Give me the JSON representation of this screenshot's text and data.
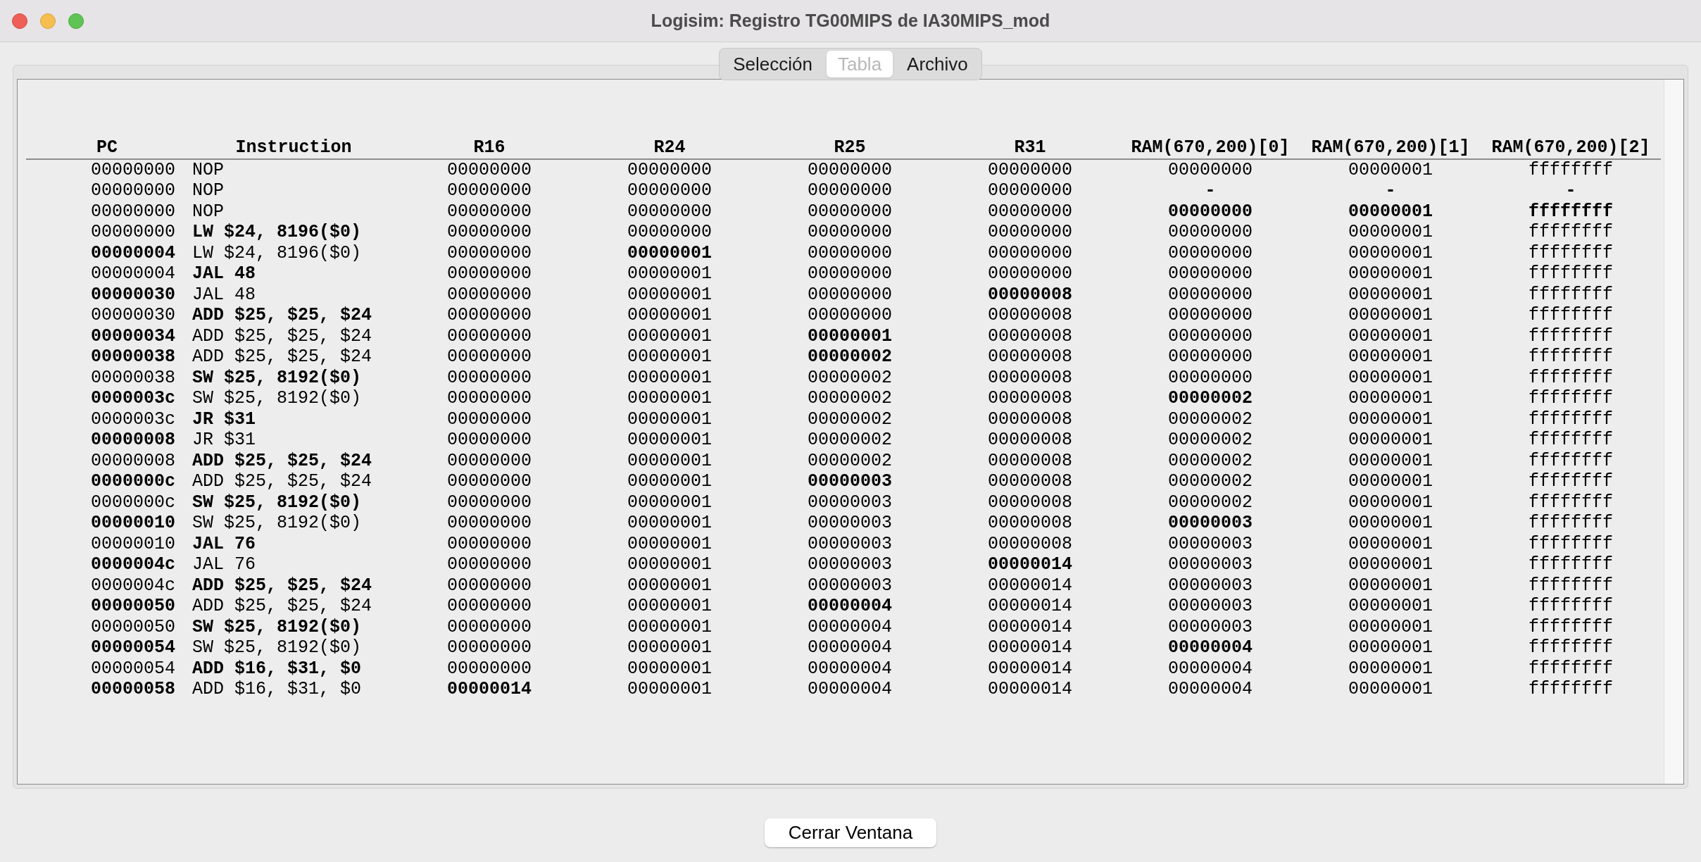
{
  "window": {
    "title": "Logisim: Registro TG00MIPS de IA30MIPS_mod"
  },
  "tabs": [
    {
      "label": "Selección",
      "selected": false
    },
    {
      "label": "Tabla",
      "selected": true
    },
    {
      "label": "Archivo",
      "selected": false
    }
  ],
  "table": {
    "columns": [
      "PC",
      "Instruction",
      "R16",
      "R24",
      "R25",
      "R31",
      "RAM(670,200)[0]",
      "RAM(670,200)[1]",
      "RAM(670,200)[2]"
    ],
    "rows": [
      {
        "cells": [
          {
            "text": "00000000",
            "changed": false
          },
          {
            "text": "NOP",
            "changed": false
          },
          {
            "text": "00000000",
            "changed": false
          },
          {
            "text": "00000000",
            "changed": false
          },
          {
            "text": "00000000",
            "changed": false
          },
          {
            "text": "00000000",
            "changed": false
          },
          {
            "text": "00000000",
            "changed": false
          },
          {
            "text": "00000001",
            "changed": false
          },
          {
            "text": "ffffffff",
            "changed": false
          }
        ]
      },
      {
        "cells": [
          {
            "text": "00000000",
            "changed": false
          },
          {
            "text": "NOP",
            "changed": false
          },
          {
            "text": "00000000",
            "changed": false
          },
          {
            "text": "00000000",
            "changed": false
          },
          {
            "text": "00000000",
            "changed": false
          },
          {
            "text": "00000000",
            "changed": false
          },
          {
            "text": "-",
            "changed": true
          },
          {
            "text": "-",
            "changed": true
          },
          {
            "text": "-",
            "changed": true
          }
        ]
      },
      {
        "cells": [
          {
            "text": "00000000",
            "changed": false
          },
          {
            "text": "NOP",
            "changed": false
          },
          {
            "text": "00000000",
            "changed": false
          },
          {
            "text": "00000000",
            "changed": false
          },
          {
            "text": "00000000",
            "changed": false
          },
          {
            "text": "00000000",
            "changed": false
          },
          {
            "text": "00000000",
            "changed": true
          },
          {
            "text": "00000001",
            "changed": true
          },
          {
            "text": "ffffffff",
            "changed": true
          }
        ]
      },
      {
        "cells": [
          {
            "text": "00000000",
            "changed": false
          },
          {
            "text": "LW $24, 8196($0)",
            "changed": true
          },
          {
            "text": "00000000",
            "changed": false
          },
          {
            "text": "00000000",
            "changed": false
          },
          {
            "text": "00000000",
            "changed": false
          },
          {
            "text": "00000000",
            "changed": false
          },
          {
            "text": "00000000",
            "changed": false
          },
          {
            "text": "00000001",
            "changed": false
          },
          {
            "text": "ffffffff",
            "changed": false
          }
        ]
      },
      {
        "cells": [
          {
            "text": "00000004",
            "changed": true
          },
          {
            "text": "LW $24, 8196($0)",
            "changed": false
          },
          {
            "text": "00000000",
            "changed": false
          },
          {
            "text": "00000001",
            "changed": true
          },
          {
            "text": "00000000",
            "changed": false
          },
          {
            "text": "00000000",
            "changed": false
          },
          {
            "text": "00000000",
            "changed": false
          },
          {
            "text": "00000001",
            "changed": false
          },
          {
            "text": "ffffffff",
            "changed": false
          }
        ]
      },
      {
        "cells": [
          {
            "text": "00000004",
            "changed": false
          },
          {
            "text": "JAL 48",
            "changed": true
          },
          {
            "text": "00000000",
            "changed": false
          },
          {
            "text": "00000001",
            "changed": false
          },
          {
            "text": "00000000",
            "changed": false
          },
          {
            "text": "00000000",
            "changed": false
          },
          {
            "text": "00000000",
            "changed": false
          },
          {
            "text": "00000001",
            "changed": false
          },
          {
            "text": "ffffffff",
            "changed": false
          }
        ]
      },
      {
        "cells": [
          {
            "text": "00000030",
            "changed": true
          },
          {
            "text": "JAL 48",
            "changed": false
          },
          {
            "text": "00000000",
            "changed": false
          },
          {
            "text": "00000001",
            "changed": false
          },
          {
            "text": "00000000",
            "changed": false
          },
          {
            "text": "00000008",
            "changed": true
          },
          {
            "text": "00000000",
            "changed": false
          },
          {
            "text": "00000001",
            "changed": false
          },
          {
            "text": "ffffffff",
            "changed": false
          }
        ]
      },
      {
        "cells": [
          {
            "text": "00000030",
            "changed": false
          },
          {
            "text": "ADD $25, $25, $24",
            "changed": true
          },
          {
            "text": "00000000",
            "changed": false
          },
          {
            "text": "00000001",
            "changed": false
          },
          {
            "text": "00000000",
            "changed": false
          },
          {
            "text": "00000008",
            "changed": false
          },
          {
            "text": "00000000",
            "changed": false
          },
          {
            "text": "00000001",
            "changed": false
          },
          {
            "text": "ffffffff",
            "changed": false
          }
        ]
      },
      {
        "cells": [
          {
            "text": "00000034",
            "changed": true
          },
          {
            "text": "ADD $25, $25, $24",
            "changed": false
          },
          {
            "text": "00000000",
            "changed": false
          },
          {
            "text": "00000001",
            "changed": false
          },
          {
            "text": "00000001",
            "changed": true
          },
          {
            "text": "00000008",
            "changed": false
          },
          {
            "text": "00000000",
            "changed": false
          },
          {
            "text": "00000001",
            "changed": false
          },
          {
            "text": "ffffffff",
            "changed": false
          }
        ]
      },
      {
        "cells": [
          {
            "text": "00000038",
            "changed": true
          },
          {
            "text": "ADD $25, $25, $24",
            "changed": false
          },
          {
            "text": "00000000",
            "changed": false
          },
          {
            "text": "00000001",
            "changed": false
          },
          {
            "text": "00000002",
            "changed": true
          },
          {
            "text": "00000008",
            "changed": false
          },
          {
            "text": "00000000",
            "changed": false
          },
          {
            "text": "00000001",
            "changed": false
          },
          {
            "text": "ffffffff",
            "changed": false
          }
        ]
      },
      {
        "cells": [
          {
            "text": "00000038",
            "changed": false
          },
          {
            "text": "SW $25, 8192($0)",
            "changed": true
          },
          {
            "text": "00000000",
            "changed": false
          },
          {
            "text": "00000001",
            "changed": false
          },
          {
            "text": "00000002",
            "changed": false
          },
          {
            "text": "00000008",
            "changed": false
          },
          {
            "text": "00000000",
            "changed": false
          },
          {
            "text": "00000001",
            "changed": false
          },
          {
            "text": "ffffffff",
            "changed": false
          }
        ]
      },
      {
        "cells": [
          {
            "text": "0000003c",
            "changed": true
          },
          {
            "text": "SW $25, 8192($0)",
            "changed": false
          },
          {
            "text": "00000000",
            "changed": false
          },
          {
            "text": "00000001",
            "changed": false
          },
          {
            "text": "00000002",
            "changed": false
          },
          {
            "text": "00000008",
            "changed": false
          },
          {
            "text": "00000002",
            "changed": true
          },
          {
            "text": "00000001",
            "changed": false
          },
          {
            "text": "ffffffff",
            "changed": false
          }
        ]
      },
      {
        "cells": [
          {
            "text": "0000003c",
            "changed": false
          },
          {
            "text": "JR $31",
            "changed": true
          },
          {
            "text": "00000000",
            "changed": false
          },
          {
            "text": "00000001",
            "changed": false
          },
          {
            "text": "00000002",
            "changed": false
          },
          {
            "text": "00000008",
            "changed": false
          },
          {
            "text": "00000002",
            "changed": false
          },
          {
            "text": "00000001",
            "changed": false
          },
          {
            "text": "ffffffff",
            "changed": false
          }
        ]
      },
      {
        "cells": [
          {
            "text": "00000008",
            "changed": true
          },
          {
            "text": "JR $31",
            "changed": false
          },
          {
            "text": "00000000",
            "changed": false
          },
          {
            "text": "00000001",
            "changed": false
          },
          {
            "text": "00000002",
            "changed": false
          },
          {
            "text": "00000008",
            "changed": false
          },
          {
            "text": "00000002",
            "changed": false
          },
          {
            "text": "00000001",
            "changed": false
          },
          {
            "text": "ffffffff",
            "changed": false
          }
        ]
      },
      {
        "cells": [
          {
            "text": "00000008",
            "changed": false
          },
          {
            "text": "ADD $25, $25, $24",
            "changed": true
          },
          {
            "text": "00000000",
            "changed": false
          },
          {
            "text": "00000001",
            "changed": false
          },
          {
            "text": "00000002",
            "changed": false
          },
          {
            "text": "00000008",
            "changed": false
          },
          {
            "text": "00000002",
            "changed": false
          },
          {
            "text": "00000001",
            "changed": false
          },
          {
            "text": "ffffffff",
            "changed": false
          }
        ]
      },
      {
        "cells": [
          {
            "text": "0000000c",
            "changed": true
          },
          {
            "text": "ADD $25, $25, $24",
            "changed": false
          },
          {
            "text": "00000000",
            "changed": false
          },
          {
            "text": "00000001",
            "changed": false
          },
          {
            "text": "00000003",
            "changed": true
          },
          {
            "text": "00000008",
            "changed": false
          },
          {
            "text": "00000002",
            "changed": false
          },
          {
            "text": "00000001",
            "changed": false
          },
          {
            "text": "ffffffff",
            "changed": false
          }
        ]
      },
      {
        "cells": [
          {
            "text": "0000000c",
            "changed": false
          },
          {
            "text": "SW $25, 8192($0)",
            "changed": true
          },
          {
            "text": "00000000",
            "changed": false
          },
          {
            "text": "00000001",
            "changed": false
          },
          {
            "text": "00000003",
            "changed": false
          },
          {
            "text": "00000008",
            "changed": false
          },
          {
            "text": "00000002",
            "changed": false
          },
          {
            "text": "00000001",
            "changed": false
          },
          {
            "text": "ffffffff",
            "changed": false
          }
        ]
      },
      {
        "cells": [
          {
            "text": "00000010",
            "changed": true
          },
          {
            "text": "SW $25, 8192($0)",
            "changed": false
          },
          {
            "text": "00000000",
            "changed": false
          },
          {
            "text": "00000001",
            "changed": false
          },
          {
            "text": "00000003",
            "changed": false
          },
          {
            "text": "00000008",
            "changed": false
          },
          {
            "text": "00000003",
            "changed": true
          },
          {
            "text": "00000001",
            "changed": false
          },
          {
            "text": "ffffffff",
            "changed": false
          }
        ]
      },
      {
        "cells": [
          {
            "text": "00000010",
            "changed": false
          },
          {
            "text": "JAL 76",
            "changed": true
          },
          {
            "text": "00000000",
            "changed": false
          },
          {
            "text": "00000001",
            "changed": false
          },
          {
            "text": "00000003",
            "changed": false
          },
          {
            "text": "00000008",
            "changed": false
          },
          {
            "text": "00000003",
            "changed": false
          },
          {
            "text": "00000001",
            "changed": false
          },
          {
            "text": "ffffffff",
            "changed": false
          }
        ]
      },
      {
        "cells": [
          {
            "text": "0000004c",
            "changed": true
          },
          {
            "text": "JAL 76",
            "changed": false
          },
          {
            "text": "00000000",
            "changed": false
          },
          {
            "text": "00000001",
            "changed": false
          },
          {
            "text": "00000003",
            "changed": false
          },
          {
            "text": "00000014",
            "changed": true
          },
          {
            "text": "00000003",
            "changed": false
          },
          {
            "text": "00000001",
            "changed": false
          },
          {
            "text": "ffffffff",
            "changed": false
          }
        ]
      },
      {
        "cells": [
          {
            "text": "0000004c",
            "changed": false
          },
          {
            "text": "ADD $25, $25, $24",
            "changed": true
          },
          {
            "text": "00000000",
            "changed": false
          },
          {
            "text": "00000001",
            "changed": false
          },
          {
            "text": "00000003",
            "changed": false
          },
          {
            "text": "00000014",
            "changed": false
          },
          {
            "text": "00000003",
            "changed": false
          },
          {
            "text": "00000001",
            "changed": false
          },
          {
            "text": "ffffffff",
            "changed": false
          }
        ]
      },
      {
        "cells": [
          {
            "text": "00000050",
            "changed": true
          },
          {
            "text": "ADD $25, $25, $24",
            "changed": false
          },
          {
            "text": "00000000",
            "changed": false
          },
          {
            "text": "00000001",
            "changed": false
          },
          {
            "text": "00000004",
            "changed": true
          },
          {
            "text": "00000014",
            "changed": false
          },
          {
            "text": "00000003",
            "changed": false
          },
          {
            "text": "00000001",
            "changed": false
          },
          {
            "text": "ffffffff",
            "changed": false
          }
        ]
      },
      {
        "cells": [
          {
            "text": "00000050",
            "changed": false
          },
          {
            "text": "SW $25, 8192($0)",
            "changed": true
          },
          {
            "text": "00000000",
            "changed": false
          },
          {
            "text": "00000001",
            "changed": false
          },
          {
            "text": "00000004",
            "changed": false
          },
          {
            "text": "00000014",
            "changed": false
          },
          {
            "text": "00000003",
            "changed": false
          },
          {
            "text": "00000001",
            "changed": false
          },
          {
            "text": "ffffffff",
            "changed": false
          }
        ]
      },
      {
        "cells": [
          {
            "text": "00000054",
            "changed": true
          },
          {
            "text": "SW $25, 8192($0)",
            "changed": false
          },
          {
            "text": "00000000",
            "changed": false
          },
          {
            "text": "00000001",
            "changed": false
          },
          {
            "text": "00000004",
            "changed": false
          },
          {
            "text": "00000014",
            "changed": false
          },
          {
            "text": "00000004",
            "changed": true
          },
          {
            "text": "00000001",
            "changed": false
          },
          {
            "text": "ffffffff",
            "changed": false
          }
        ]
      },
      {
        "cells": [
          {
            "text": "00000054",
            "changed": false
          },
          {
            "text": "ADD $16, $31, $0",
            "changed": true
          },
          {
            "text": "00000000",
            "changed": false
          },
          {
            "text": "00000001",
            "changed": false
          },
          {
            "text": "00000004",
            "changed": false
          },
          {
            "text": "00000014",
            "changed": false
          },
          {
            "text": "00000004",
            "changed": false
          },
          {
            "text": "00000001",
            "changed": false
          },
          {
            "text": "ffffffff",
            "changed": false
          }
        ]
      },
      {
        "cells": [
          {
            "text": "00000058",
            "changed": true
          },
          {
            "text": "ADD $16, $31, $0",
            "changed": false
          },
          {
            "text": "00000014",
            "changed": true
          },
          {
            "text": "00000001",
            "changed": false
          },
          {
            "text": "00000004",
            "changed": false
          },
          {
            "text": "00000014",
            "changed": false
          },
          {
            "text": "00000004",
            "changed": false
          },
          {
            "text": "00000001",
            "changed": false
          },
          {
            "text": "ffffffff",
            "changed": false
          }
        ]
      }
    ]
  },
  "buttons": [
    "Cerrar Ventana"
  ]
}
